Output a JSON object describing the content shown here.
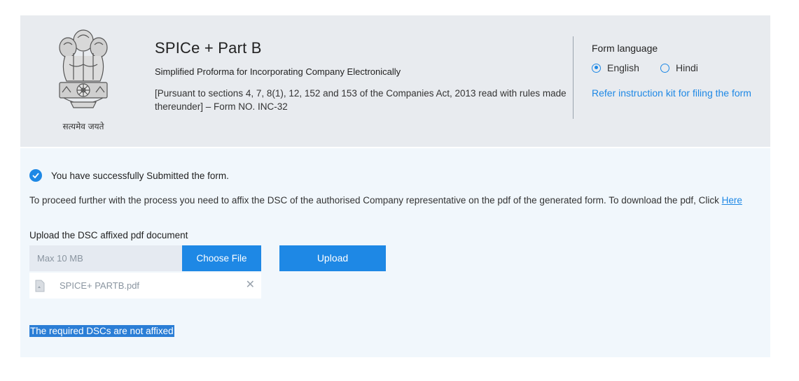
{
  "header": {
    "emblem_caption": "सत्यमेव जयते",
    "title": "SPICe + Part B",
    "subtitle": "Simplified Proforma for Incorporating Company Electronically",
    "pursuant": "[Pursuant to sections 4, 7, 8(1), 12, 152 and 153 of the Companies Act, 2013 read with rules made thereunder] – Form NO. INC-32"
  },
  "language": {
    "title": "Form language",
    "options": [
      {
        "label": "English",
        "selected": true
      },
      {
        "label": "Hindi",
        "selected": false
      }
    ],
    "refer_link": "Refer instruction kit for filing the form"
  },
  "content": {
    "success_message": "You have successfully Submitted the form.",
    "instruction_text": "To proceed further with the process you need to affix the DSC of the authorised Company representative on the pdf of the generated form. To download the pdf, Click ",
    "instruction_link": "Here",
    "upload_label": "Upload the DSC affixed pdf document",
    "file_placeholder": "Max 10 MB",
    "choose_file_label": "Choose File",
    "upload_label_button": "Upload",
    "selected_file": "SPICE+ PARTB.pdf",
    "warning_text": "The required DSCs are not affixed"
  },
  "colors": {
    "accent": "#1e88e5",
    "header_bg": "#e8ebef",
    "content_bg": "#f1f7fc"
  },
  "icons": [
    "national-emblem",
    "check-circle-icon",
    "pdf-file-icon",
    "close-icon",
    "radio-icon"
  ]
}
